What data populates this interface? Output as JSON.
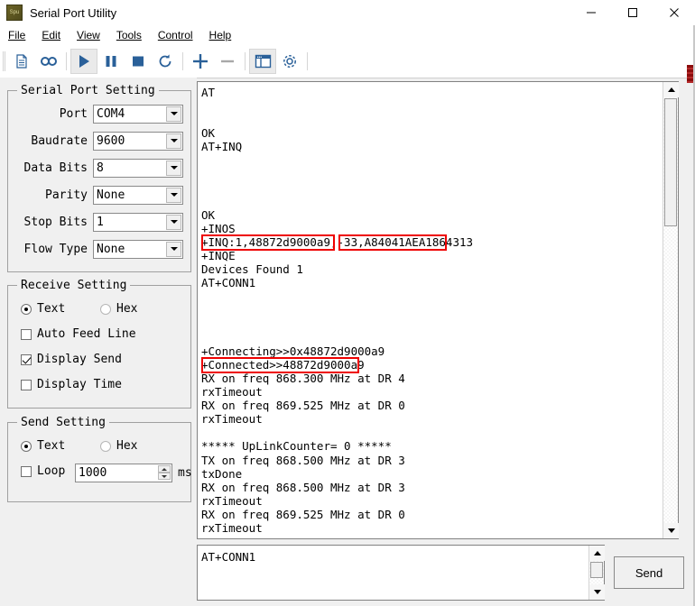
{
  "window": {
    "title": "Serial Port Utility",
    "icon": "spu-app-icon",
    "icon_text": "Spu",
    "controls": {
      "minimize": "minimize-icon",
      "maximize": "maximize-icon",
      "close": "close-icon"
    }
  },
  "menubar": {
    "items": [
      {
        "label": "File",
        "accel": "F"
      },
      {
        "label": "Edit",
        "accel": "E"
      },
      {
        "label": "View",
        "accel": "V"
      },
      {
        "label": "Tools",
        "accel": "T"
      },
      {
        "label": "Control",
        "accel": "C"
      },
      {
        "label": "Help",
        "accel": "H"
      }
    ]
  },
  "toolbar": {
    "buttons": [
      {
        "name": "new-document-icon",
        "state": "normal"
      },
      {
        "name": "record-icon",
        "state": "normal"
      },
      {
        "name": "play-icon",
        "state": "active"
      },
      {
        "name": "pause-icon",
        "state": "normal"
      },
      {
        "name": "stop-icon",
        "state": "normal"
      },
      {
        "name": "refresh-icon",
        "state": "normal"
      },
      {
        "name": "add-icon",
        "state": "normal"
      },
      {
        "name": "remove-icon",
        "state": "disabled"
      },
      {
        "name": "panel-layout-icon",
        "state": "active"
      },
      {
        "name": "settings-gear-icon",
        "state": "normal"
      }
    ]
  },
  "serial_port_setting": {
    "title": "Serial Port Setting",
    "fields": [
      {
        "label": "Port",
        "value": "COM4"
      },
      {
        "label": "Baudrate",
        "value": "9600"
      },
      {
        "label": "Data Bits",
        "value": "8"
      },
      {
        "label": "Parity",
        "value": "None"
      },
      {
        "label": "Stop Bits",
        "value": "1"
      },
      {
        "label": "Flow Type",
        "value": "None"
      }
    ]
  },
  "receive_setting": {
    "title": "Receive Setting",
    "mode": {
      "text_label": "Text",
      "text_selected": true,
      "hex_label": "Hex",
      "hex_selected": false
    },
    "options": [
      {
        "label": "Auto Feed Line",
        "checked": false
      },
      {
        "label": "Display Send",
        "checked": true
      },
      {
        "label": "Display Time",
        "checked": false
      }
    ]
  },
  "send_setting": {
    "title": "Send Setting",
    "mode": {
      "text_label": "Text",
      "text_selected": true,
      "hex_label": "Hex",
      "hex_selected": false
    },
    "loop": {
      "label": "Loop",
      "checked": false,
      "interval": "1000",
      "unit": "ms"
    }
  },
  "terminal": {
    "lines": [
      "AT",
      "",
      "",
      "OK",
      "AT+INQ",
      "",
      "",
      "",
      "",
      "OK",
      "+INOS",
      "+INQ:1,48872d9000a9,-33,A84041AEA1864313",
      "+INQE",
      "Devices Found 1",
      "AT+CONN1",
      "",
      "",
      "",
      "",
      "+Connecting>>0x48872d9000a9",
      "+Connected>>48872d9000a9",
      "RX on freq 868.300 MHz at DR 4",
      "rxTimeout",
      "RX on freq 869.525 MHz at DR 0",
      "rxTimeout",
      "",
      "***** UpLinkCounter= 0 *****",
      "TX on freq 868.500 MHz at DR 3",
      "txDone",
      "RX on freq 868.500 MHz at DR 3",
      "rxTimeout",
      "RX on freq 869.525 MHz at DR 0",
      "rxTimeout"
    ],
    "highlights": [
      {
        "name": "highlight-inq-device-address",
        "text": "+INQ:1,48872d9000a9",
        "color": "#ee0000"
      },
      {
        "name": "highlight-inq-device-uuid",
        "text": "A84041AEA1864313",
        "color": "#ee0000"
      },
      {
        "name": "highlight-connected-address",
        "text": "+Connected>>48872d9000a9",
        "color": "#ee0000"
      }
    ],
    "scrollbar": {
      "name": "terminal-vertical-scrollbar",
      "thumb_position": "top"
    }
  },
  "send_area": {
    "value": "AT+CONN1",
    "button_label": "Send",
    "scrollbar": {
      "name": "send-vertical-scrollbar"
    }
  }
}
